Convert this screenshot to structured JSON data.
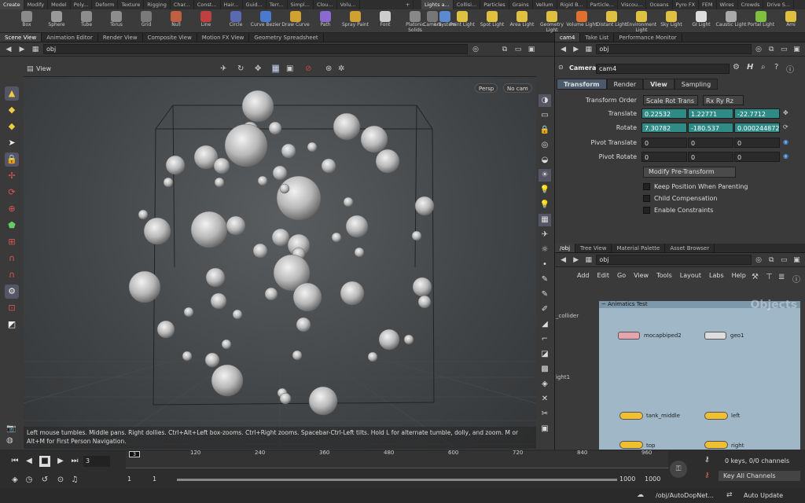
{
  "shelf_tabs_left": [
    "Create",
    "Modify",
    "Model",
    "Poly...",
    "Deform",
    "Texture",
    "Rigging",
    "Char...",
    "Const...",
    "Hair...",
    "Guid...",
    "Terr...",
    "Simpl...",
    "Clou...",
    "Volu..."
  ],
  "shelf_tabs_right": [
    "Lights a...",
    "Collisi...",
    "Particles",
    "Grains",
    "Vellum",
    "Rigid B...",
    "Particle...",
    "Viscou...",
    "Oceans",
    "Pyro FX",
    "FEM",
    "Wires",
    "Crowds",
    "Drive S..."
  ],
  "shelf_tools_left": [
    {
      "label": "Box",
      "icon": "box-icon",
      "color": "#8a8a8a"
    },
    {
      "label": "Sphere",
      "icon": "sphere-icon",
      "color": "#9a9a9a"
    },
    {
      "label": "Tube",
      "icon": "tube-icon",
      "color": "#8d8d8d"
    },
    {
      "label": "Torus",
      "icon": "torus-icon",
      "color": "#8d8d8d"
    },
    {
      "label": "Grid",
      "icon": "grid-icon",
      "color": "#7a7a7a"
    },
    {
      "label": "Null",
      "icon": "null-icon",
      "color": "#c06040"
    },
    {
      "label": "Line",
      "icon": "line-icon",
      "color": "#c04040"
    },
    {
      "label": "Circle",
      "icon": "circle-icon",
      "color": "#5a6ab0"
    },
    {
      "label": "Curve Bezier",
      "icon": "curve-bezier-icon",
      "color": "#4a7ad0"
    },
    {
      "label": "Draw Curve",
      "icon": "draw-curve-icon",
      "color": "#d0a030"
    },
    {
      "label": "Path",
      "icon": "path-icon",
      "color": "#8a6ad0"
    },
    {
      "label": "Spray Paint",
      "icon": "spray-paint-icon",
      "color": "#d0a030"
    },
    {
      "label": "Font",
      "icon": "font-icon",
      "color": "#cccccc"
    },
    {
      "label": "Platonic Solids",
      "icon": "platonic-icon",
      "color": "#888888"
    },
    {
      "label": "L-System",
      "icon": "lsystem-icon",
      "color": "#5a8ad0"
    }
  ],
  "shelf_tools_right": [
    {
      "label": "Camera",
      "icon": "camera-icon",
      "color": "#777777"
    },
    {
      "label": "Point Light",
      "icon": "point-light-icon",
      "color": "#e0c040"
    },
    {
      "label": "Spot Light",
      "icon": "spot-light-icon",
      "color": "#e0c040"
    },
    {
      "label": "Area Light",
      "icon": "area-light-icon",
      "color": "#e0c040"
    },
    {
      "label": "Geometry Light",
      "icon": "geometry-light-icon",
      "color": "#e0c040"
    },
    {
      "label": "Volume Light",
      "icon": "volume-light-icon",
      "color": "#e07030"
    },
    {
      "label": "Distant Light",
      "icon": "distant-light-icon",
      "color": "#e0c040"
    },
    {
      "label": "Environment Light",
      "icon": "environment-light-icon",
      "color": "#e0c040"
    },
    {
      "label": "Sky Light",
      "icon": "sky-light-icon",
      "color": "#e0c040"
    },
    {
      "label": "GI Light",
      "icon": "gi-light-icon",
      "color": "#dddddd"
    },
    {
      "label": "Caustic Light",
      "icon": "caustic-light-icon",
      "color": "#aaaaaa"
    },
    {
      "label": "Portal Light",
      "icon": "portal-light-icon",
      "color": "#80c040"
    },
    {
      "label": "Ami",
      "icon": "ambient-light-icon",
      "color": "#e0c040"
    }
  ],
  "left_pane_tabs": [
    "Scene View",
    "Animation Editor",
    "Render View",
    "Composite View",
    "Motion FX View",
    "Geometry Spreadsheet"
  ],
  "left_path": "obj",
  "viewport": {
    "title": "View",
    "persp": "Persp",
    "cam": "No cam",
    "hint": "Left mouse tumbles. Middle pans. Right dollies. Ctrl+Alt+Left box-zooms. Ctrl+Right zooms. Spacebar-Ctrl-Left tilts. Hold L for alternate tumble, dolly, and zoom.    M or Alt+M for First Person Navigation."
  },
  "right_top_tabs": [
    "cam4",
    "Take List",
    "Performance Monitor"
  ],
  "right_path": "obj",
  "params": {
    "type_label": "Camera",
    "node_name": "cam4",
    "tabs": [
      "Transform",
      "Render",
      "View",
      "Sampling"
    ],
    "transform_order_label": "Transform Order",
    "transform_order": "Scale Rot Trans",
    "rot_order": "Rx Ry Rz",
    "translate_label": "Translate",
    "translate": [
      "0.22532",
      "1.22771",
      "-22.7712"
    ],
    "rotate_label": "Rotate",
    "rotate": [
      "7.30782",
      "-180.537",
      "0.000244872"
    ],
    "pivot_translate_label": "Pivot Translate",
    "pivot_translate": [
      "0",
      "0",
      "0"
    ],
    "pivot_rotate_label": "Pivot Rotate",
    "pivot_rotate": [
      "0",
      "0",
      "0"
    ],
    "modify_pre_transform": "Modify Pre-Transform",
    "checkboxes": [
      "Keep Position When Parenting",
      "Child Compensation",
      "Enable Constraints"
    ]
  },
  "net_tabs": [
    "/obj",
    "Tree View",
    "Material Palette",
    "Asset Browser"
  ],
  "net_path": "obj",
  "net_menu": [
    "Add",
    "Edit",
    "Go",
    "View",
    "Tools",
    "Layout",
    "Labs",
    "Help"
  ],
  "network": {
    "box_title": "Animatics Test",
    "watermark": "Objects",
    "side_labels": [
      "_collider",
      "ight1"
    ],
    "nodes": [
      "mocapbiped2",
      "geo1",
      "tank_middle",
      "left",
      "top",
      "right"
    ]
  },
  "timeline": {
    "frame": "3",
    "ticks": [
      "120",
      "240",
      "360",
      "480",
      "600",
      "720",
      "840",
      "960"
    ],
    "start": "1",
    "start2": "1",
    "end": "1000",
    "end2": "1000",
    "keys_info": "0 keys, 0/0 channels",
    "key_all": "Key All Channels"
  },
  "status": {
    "path": "/obj/AutoDopNet...",
    "update": "Auto Update"
  }
}
